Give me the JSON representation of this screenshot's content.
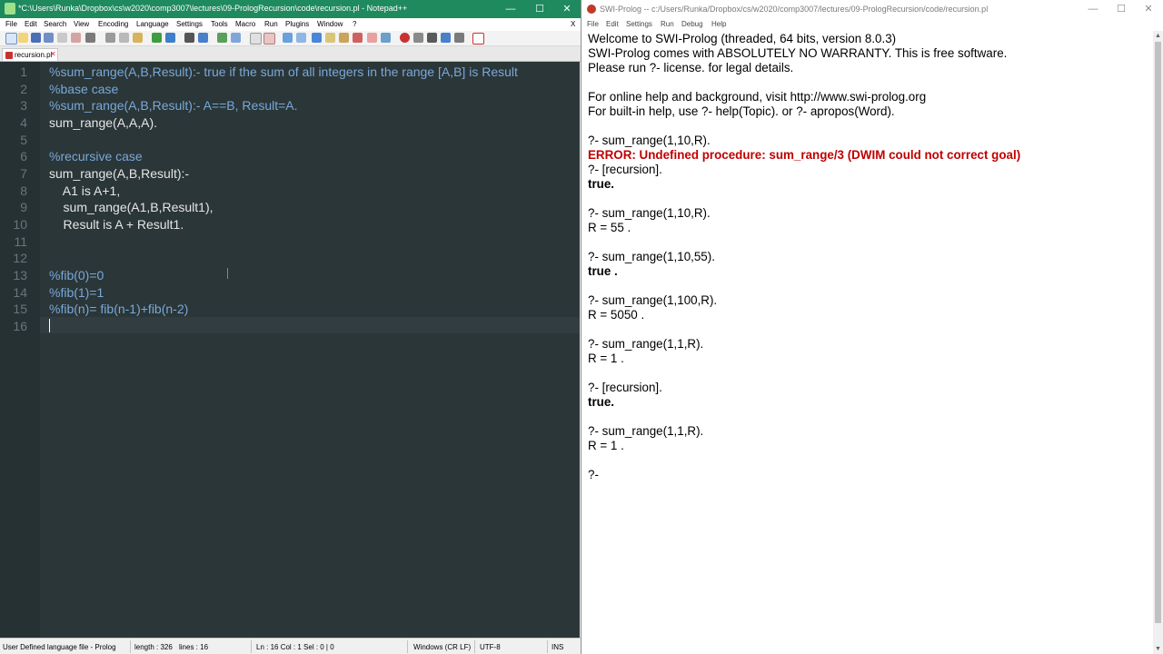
{
  "npp": {
    "title": "*C:\\Users\\Runka\\Dropbox\\cs\\w2020\\comp3007\\lectures\\09-PrologRecursion\\code\\recursion.pl - Notepad++",
    "menu": [
      "File",
      "Edit",
      "Search",
      "View",
      "Encoding",
      "Language",
      "Settings",
      "Tools",
      "Macro",
      "Run",
      "Plugins",
      "Window",
      "?"
    ],
    "menu_close": "X",
    "tab_label": "recursion.pl",
    "tab_close": "✕",
    "lines": [
      {
        "n": "1",
        "text": "%sum_range(A,B,Result):- true if the sum of all integers in the range [A,B] is Result",
        "kind": "comment"
      },
      {
        "n": "2",
        "text": "%base case",
        "kind": "comment"
      },
      {
        "n": "3",
        "text": "%sum_range(A,B,Result):- A==B, Result=A.",
        "kind": "comment"
      },
      {
        "n": "4",
        "text": "sum_range(A,A,A).",
        "kind": "plain"
      },
      {
        "n": "5",
        "text": "",
        "kind": "plain"
      },
      {
        "n": "6",
        "text": "%recursive case",
        "kind": "comment"
      },
      {
        "n": "7",
        "text": "sum_range(A,B,Result):-",
        "kind": "plain"
      },
      {
        "n": "8",
        "text": "    A1 is A+1,",
        "kind": "plain"
      },
      {
        "n": "9",
        "text": "    sum_range(A1,B,Result1),",
        "kind": "plain"
      },
      {
        "n": "10",
        "text": "    Result is A + Result1.",
        "kind": "plain"
      },
      {
        "n": "11",
        "text": "",
        "kind": "plain"
      },
      {
        "n": "12",
        "text": "",
        "kind": "plain"
      },
      {
        "n": "13",
        "text": "%fib(0)=0",
        "kind": "comment"
      },
      {
        "n": "14",
        "text": "%fib(1)=1",
        "kind": "comment"
      },
      {
        "n": "15",
        "text": "%fib(n)= fib(n-1)+fib(n-2)",
        "kind": "comment"
      },
      {
        "n": "16",
        "text": "",
        "kind": "plain"
      }
    ],
    "status": {
      "language": "User Defined language file - Prolog",
      "length": "length : 326",
      "lines": "lines : 16",
      "position": "Ln : 16    Col : 1    Sel : 0 | 0",
      "eol": "Windows (CR LF)",
      "encoding": "UTF-8",
      "mode": "INS"
    },
    "colors": {
      "title_bar": "#1e8a5e",
      "editor_bg": "#2b3638",
      "comment": "#79a8d8",
      "code": "#e6e6e6"
    }
  },
  "swi": {
    "title": "SWI-Prolog -- c:/Users/Runka/Dropbox/cs/w2020/comp3007/lectures/09-PrologRecursion/code/recursion.pl",
    "menu": [
      "File",
      "Edit",
      "Settings",
      "Run",
      "Debug",
      "Help"
    ],
    "console": [
      {
        "text": "Welcome to SWI-Prolog (threaded, 64 bits, version 8.0.3)",
        "style": "normal"
      },
      {
        "text": "SWI-Prolog comes with ABSOLUTELY NO WARRANTY. This is free software.",
        "style": "normal"
      },
      {
        "text": "Please run ?- license. for legal details.",
        "style": "normal"
      },
      {
        "text": "",
        "style": "normal"
      },
      {
        "text": "For online help and background, visit http://www.swi-prolog.org",
        "style": "normal"
      },
      {
        "text": "For built-in help, use ?- help(Topic). or ?- apropos(Word).",
        "style": "normal"
      },
      {
        "text": "",
        "style": "normal"
      },
      {
        "text": "?- sum_range(1,10,R).",
        "style": "normal"
      },
      {
        "text": "ERROR: Undefined procedure: sum_range/3 (DWIM could not correct goal)",
        "style": "error"
      },
      {
        "text": "?- [recursion].",
        "style": "normal"
      },
      {
        "text": "true.",
        "style": "bold"
      },
      {
        "text": "",
        "style": "normal"
      },
      {
        "text": "?- sum_range(1,10,R).",
        "style": "normal"
      },
      {
        "text": "R = 55 .",
        "style": "normal"
      },
      {
        "text": "",
        "style": "normal"
      },
      {
        "text": "?- sum_range(1,10,55).",
        "style": "normal"
      },
      {
        "text": "true .",
        "style": "bold"
      },
      {
        "text": "",
        "style": "normal"
      },
      {
        "text": "?- sum_range(1,100,R).",
        "style": "normal"
      },
      {
        "text": "R = 5050 .",
        "style": "normal"
      },
      {
        "text": "",
        "style": "normal"
      },
      {
        "text": "?- sum_range(1,1,R).",
        "style": "normal"
      },
      {
        "text": "R = 1 .",
        "style": "normal"
      },
      {
        "text": "",
        "style": "normal"
      },
      {
        "text": "?- [recursion].",
        "style": "normal"
      },
      {
        "text": "true.",
        "style": "bold"
      },
      {
        "text": "",
        "style": "normal"
      },
      {
        "text": "?- sum_range(1,1,R).",
        "style": "normal"
      },
      {
        "text": "R = 1 .",
        "style": "normal"
      },
      {
        "text": "",
        "style": "normal"
      },
      {
        "text": "?-",
        "style": "normal"
      }
    ],
    "colors": {
      "error": "#c00000"
    }
  },
  "caption_buttons": {
    "minimize": "—",
    "maximize": "☐",
    "close": "✕"
  },
  "icons": [
    "notepadpp-icon",
    "swi-prolog-owl-icon",
    "save-icon",
    "undo-icon",
    "redo-icon",
    "find-icon",
    "zoom-in-icon",
    "record-macro-icon",
    "play-macro-icon",
    "spellcheck-icon"
  ]
}
